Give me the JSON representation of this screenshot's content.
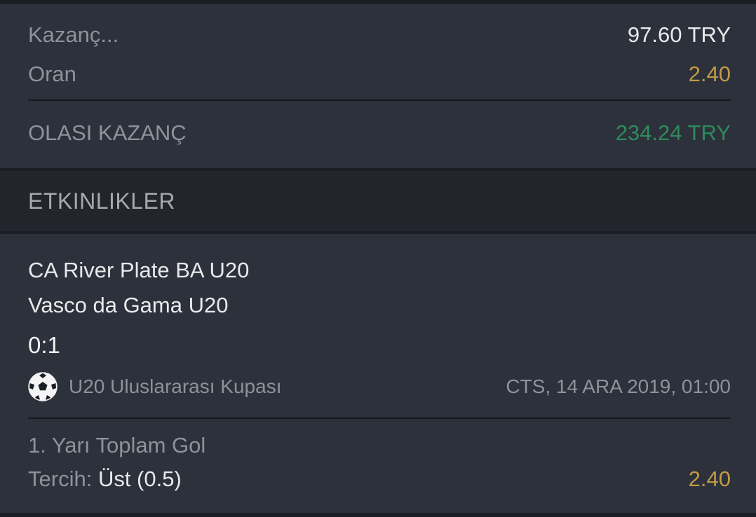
{
  "summary": {
    "stake_label": "Kazanç...",
    "stake_value": "97.60 TRY",
    "odds_label": "Oran",
    "odds_value": "2.40",
    "potential_label": "OLASI KAZANÇ",
    "potential_value": "234.24 TRY"
  },
  "events_section": {
    "title": "ETKINLIKLER"
  },
  "event": {
    "home_team": "CA River Plate BA U20",
    "away_team": "Vasco da Gama U20",
    "score": "0:1",
    "sport_icon": "soccer-ball-icon",
    "league": "U20 Uluslararası Kupası",
    "datetime": "CTS, 14 ARA 2019, 01:00",
    "market": "1. Yarı Toplam Gol",
    "selection_label": "Tercih:",
    "selection_value": "Üst (0.5)",
    "selection_odds": "2.40"
  },
  "colors": {
    "background": "#1b1e24",
    "panel": "#2d313b",
    "header": "#22252c",
    "gold": "#c39a45",
    "green": "#2f8a5c"
  }
}
